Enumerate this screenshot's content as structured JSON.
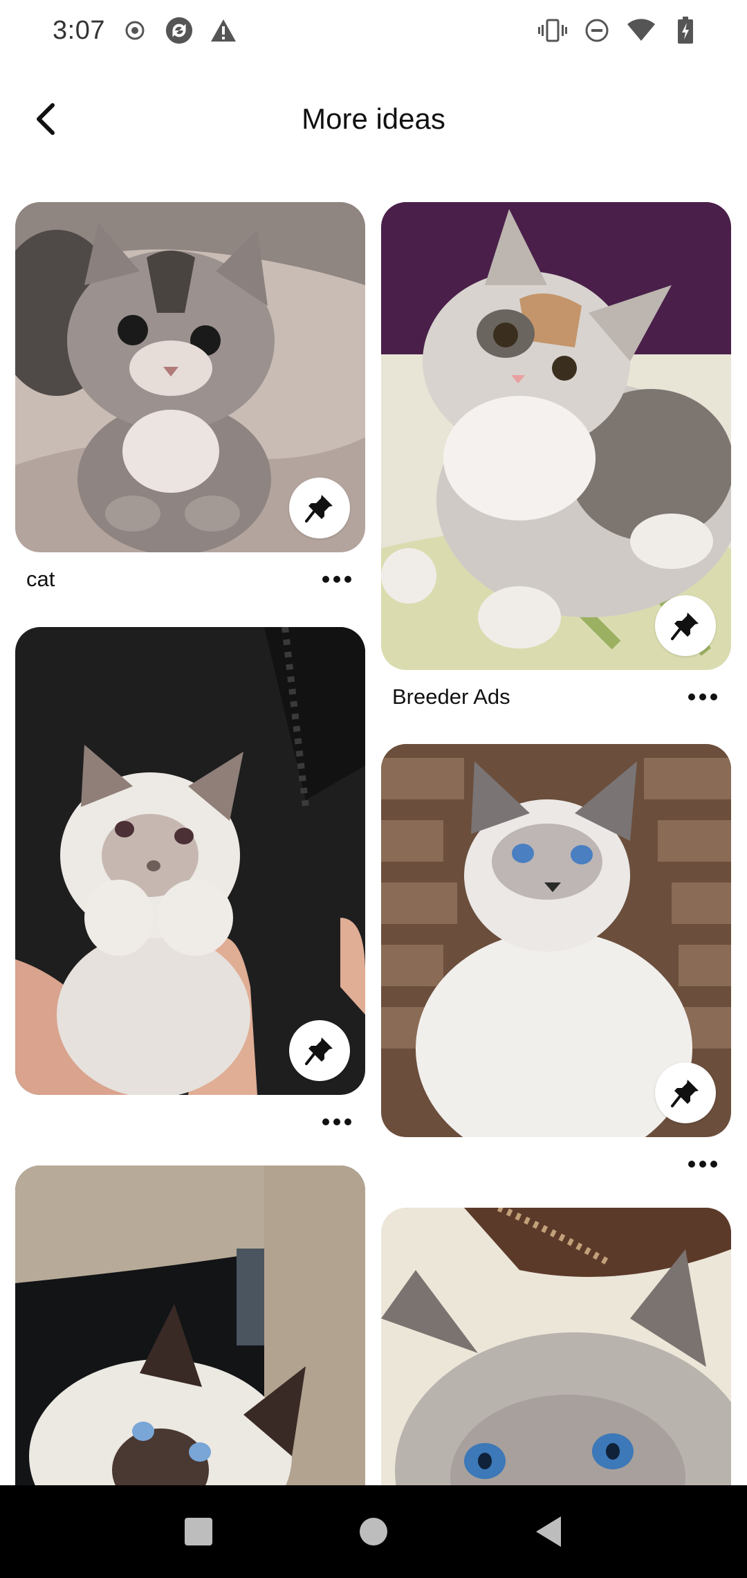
{
  "status_bar": {
    "time": "3:07",
    "left_icons": [
      "record-icon",
      "sync-icon",
      "warning-icon"
    ],
    "right_icons": [
      "vibrate-icon",
      "do-not-disturb-icon",
      "wifi-icon",
      "battery-charging-icon"
    ]
  },
  "header": {
    "title": "More ideas",
    "back_icon": "chevron-left-icon"
  },
  "pins": [
    {
      "title": "cat",
      "subject": "grey tabby kitten",
      "save_icon": "pushpin-icon",
      "more_icon": "more-horizontal-icon"
    },
    {
      "title": "Breeder Ads",
      "subject": "calico fluffy kitten",
      "save_icon": "pushpin-icon",
      "more_icon": "more-horizontal-icon"
    },
    {
      "title": "",
      "subject": "white ragdoll kitten held in hand",
      "save_icon": "pushpin-icon",
      "more_icon": "more-horizontal-icon"
    },
    {
      "title": "",
      "subject": "blue-eyed ragdoll cat",
      "save_icon": "pushpin-icon",
      "more_icon": "more-horizontal-icon"
    },
    {
      "title": "",
      "subject": "seal point kitten on cat tree",
      "save_icon": "",
      "more_icon": ""
    },
    {
      "title": "",
      "subject": "blue-eyed grey cat close-up",
      "save_icon": "",
      "more_icon": ""
    }
  ],
  "nav_bar": {
    "buttons": [
      "recents-square-icon",
      "home-circle-icon",
      "back-triangle-icon"
    ]
  },
  "colors": {
    "background": "#ffffff",
    "text": "#111111",
    "nav_bar": "#000000",
    "save_button_bg": "#ffffff"
  }
}
